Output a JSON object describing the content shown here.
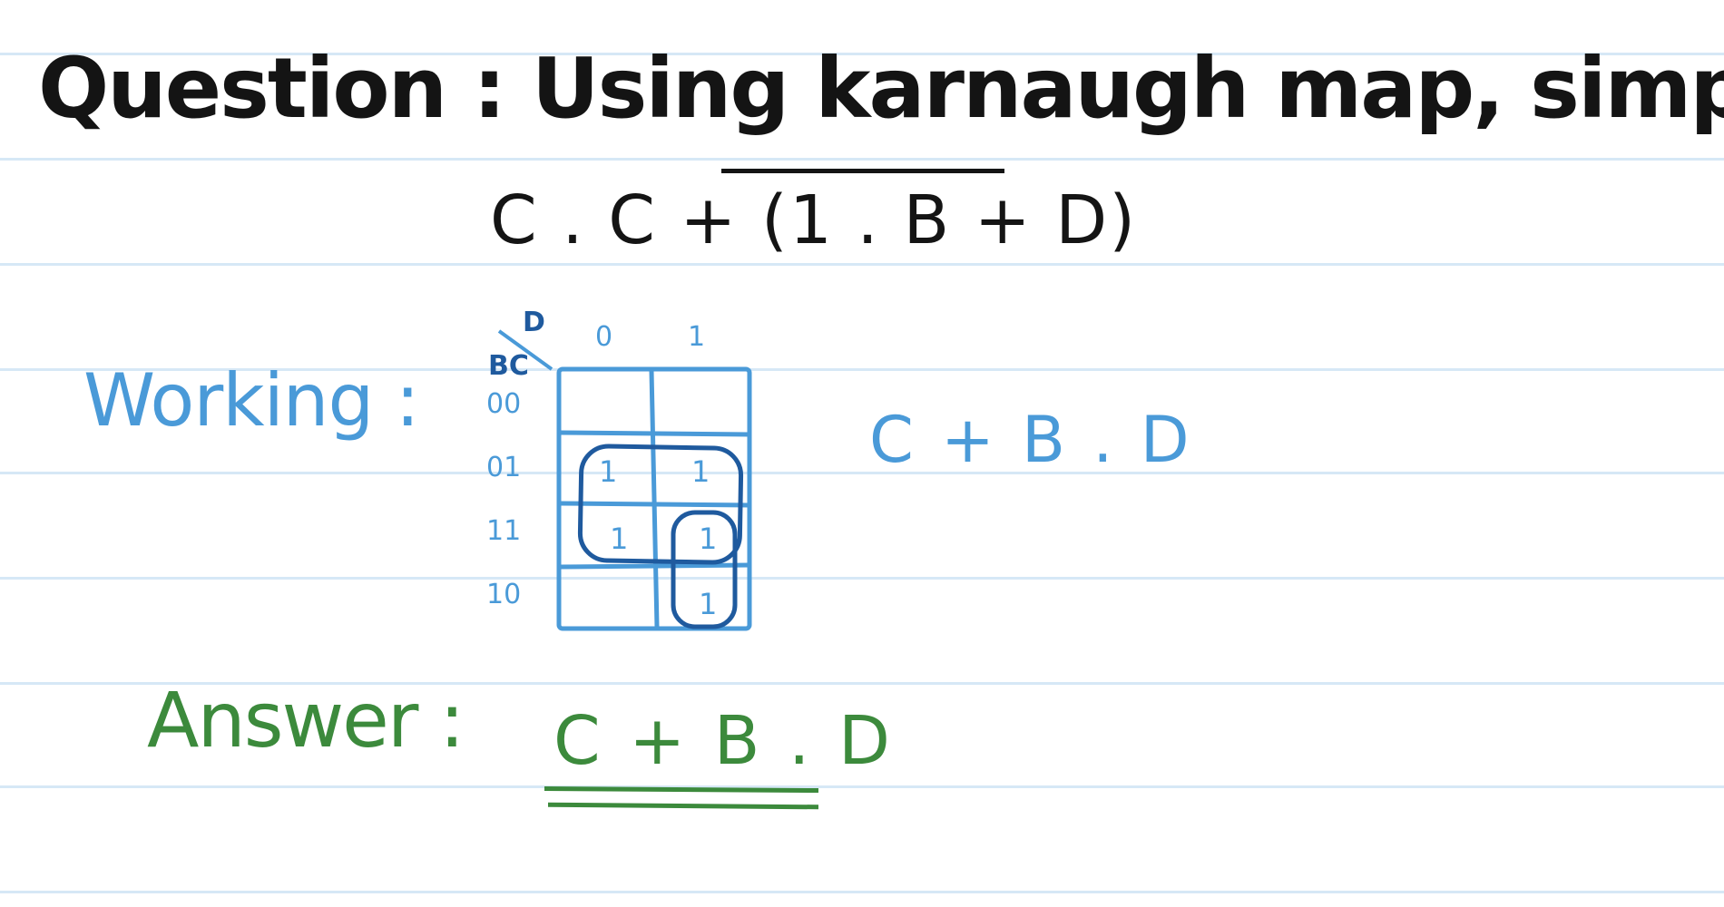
{
  "page": {
    "line_color": "#d6e8f6",
    "ink_colors": {
      "question": "#141414",
      "working": "#4a9ad8",
      "group_circle": "#1f5a9e",
      "answer": "#3c8a3c"
    }
  },
  "question": {
    "text": "Question : Using karnaugh map, simplify :",
    "expression": "C . C + (1 . B + D)"
  },
  "working": {
    "label": "Working :",
    "result": "C + B . D",
    "kmap": {
      "column_variable": "D",
      "row_variables": "BC",
      "column_headers": [
        "0",
        "1"
      ],
      "row_headers": [
        "00",
        "01",
        "11",
        "10"
      ],
      "cells": [
        [
          "",
          ""
        ],
        [
          "1",
          "1"
        ],
        [
          "1",
          "1"
        ],
        [
          "",
          "1"
        ]
      ]
    }
  },
  "answer": {
    "label": "Answer :",
    "value": "C + B . D"
  }
}
